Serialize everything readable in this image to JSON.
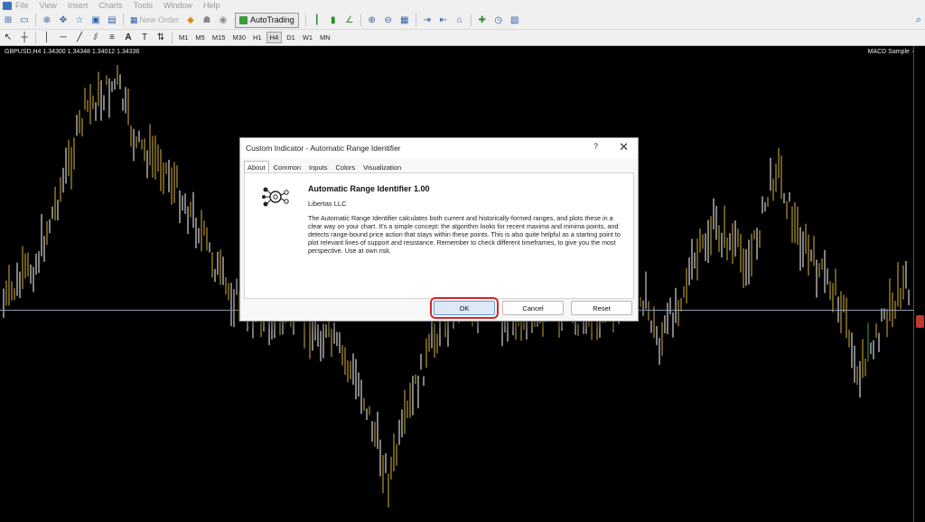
{
  "menu": [
    "File",
    "View",
    "Insert",
    "Charts",
    "Tools",
    "Window",
    "Help"
  ],
  "toolbar": {
    "new_order": "New Order",
    "autotrading": "AutoTrading"
  },
  "timeframes": [
    {
      "label": "M1",
      "active": false
    },
    {
      "label": "M5",
      "active": false
    },
    {
      "label": "M15",
      "active": false
    },
    {
      "label": "M30",
      "active": false
    },
    {
      "label": "H1",
      "active": false
    },
    {
      "label": "H4",
      "active": true
    },
    {
      "label": "D1",
      "active": false
    },
    {
      "label": "W1",
      "active": false
    },
    {
      "label": "MN",
      "active": false
    }
  ],
  "chart": {
    "symbol_info": "GBPUSD,H4  1.34300 1.34348 1.34012 1.34336",
    "expert": "MACD Sample ☺",
    "candle_colors": {
      "bull": "#d7b23a",
      "bear": "#ffffff",
      "accent": "#43a047"
    }
  },
  "dialog": {
    "title": "Custom Indicator - Automatic Range Identifier",
    "help": "?",
    "close": "✕",
    "tabs": [
      "About",
      "Common",
      "Inputs",
      "Colors",
      "Visualization"
    ],
    "indicator_name": "Automatic Range Identifier 1.00",
    "author": "Libertas LLC",
    "description": "The Automatic Range Identifier calculates both current and historically-formed ranges, and plots these in a clear way on your chart. It's a simple concept: the algorithm looks for recent maxima and minima points, and detects range-bound price action that stays within these points. This is also quite helpful as a starting point to plot relevant lines of support and resistance. Remember to check different timeframes, to give you the most perspective. Use at own risk.",
    "buttons": {
      "ok": "OK",
      "cancel": "Cancel",
      "reset": "Reset"
    }
  }
}
